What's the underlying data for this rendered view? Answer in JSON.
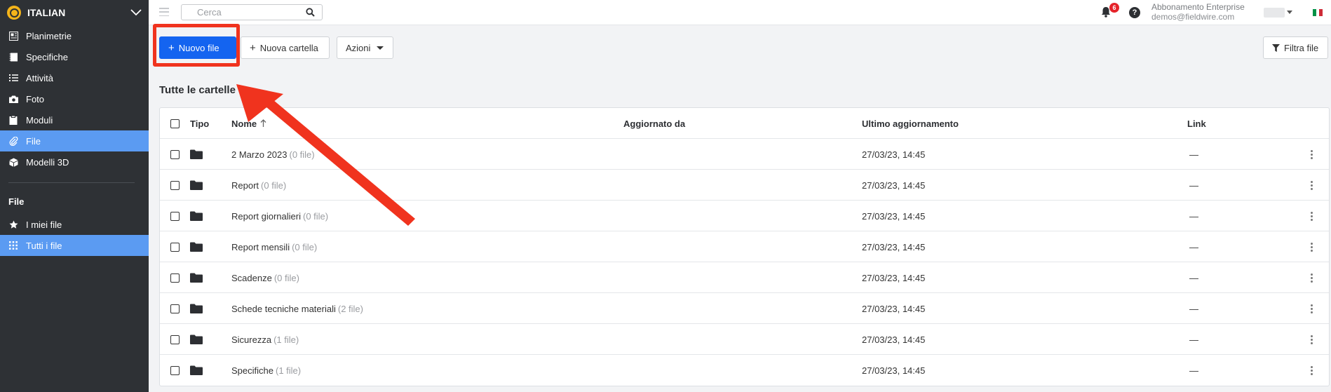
{
  "sidebar": {
    "project_name": "ITALIAN",
    "nav": [
      {
        "label": "Planimetrie",
        "icon": "plans-icon"
      },
      {
        "label": "Specifiche",
        "icon": "specs-icon"
      },
      {
        "label": "Attività",
        "icon": "tasks-icon"
      },
      {
        "label": "Foto",
        "icon": "camera-icon"
      },
      {
        "label": "Moduli",
        "icon": "forms-icon"
      },
      {
        "label": "File",
        "icon": "paperclip-icon"
      },
      {
        "label": "Modelli 3D",
        "icon": "cube-icon"
      }
    ],
    "section_label": "File",
    "sub_nav": [
      {
        "label": "I miei file",
        "icon": "star-icon"
      },
      {
        "label": "Tutti i file",
        "icon": "grid-icon"
      }
    ]
  },
  "topbar": {
    "search_placeholder": "Cerca",
    "notification_count": "6",
    "help_label": "?",
    "plan_name": "Abbonamento Enterprise",
    "user_email": "demos@fieldwire.com",
    "flag_colors": [
      "#009246",
      "#ffffff",
      "#ce2b37"
    ]
  },
  "toolbar": {
    "new_file_label": "Nuovo file",
    "new_folder_label": "Nuova cartella",
    "actions_label": "Azioni",
    "filter_label": "Filtra file"
  },
  "colors": {
    "primary": "#1464f0",
    "sidebar_bg": "#2e3135",
    "sidebar_active": "#5b9bf2",
    "annotation": "#f0331e"
  },
  "section_title": "Tutte le cartelle",
  "table": {
    "columns": {
      "type": "Tipo",
      "name": "Nome",
      "updated_by": "Aggiornato da",
      "last_updated": "Ultimo aggiornamento",
      "link": "Link"
    },
    "rows": [
      {
        "name": "2 Marzo 2023",
        "count": "(0 file)",
        "updated_by": "",
        "updated": "27/03/23, 14:45",
        "link": "—"
      },
      {
        "name": "Report",
        "count": "(0 file)",
        "updated_by": "",
        "updated": "27/03/23, 14:45",
        "link": "—"
      },
      {
        "name": "Report giornalieri",
        "count": "(0 file)",
        "updated_by": "",
        "updated": "27/03/23, 14:45",
        "link": "—"
      },
      {
        "name": "Report mensili",
        "count": "(0 file)",
        "updated_by": "",
        "updated": "27/03/23, 14:45",
        "link": "—"
      },
      {
        "name": "Scadenze",
        "count": "(0 file)",
        "updated_by": "",
        "updated": "27/03/23, 14:45",
        "link": "—"
      },
      {
        "name": "Schede tecniche materiali",
        "count": "(2 file)",
        "updated_by": "",
        "updated": "27/03/23, 14:45",
        "link": "—"
      },
      {
        "name": "Sicurezza",
        "count": "(1 file)",
        "updated_by": "",
        "updated": "27/03/23, 14:45",
        "link": "—"
      },
      {
        "name": "Specifiche",
        "count": "(1 file)",
        "updated_by": "",
        "updated": "27/03/23, 14:45",
        "link": "—"
      }
    ]
  }
}
